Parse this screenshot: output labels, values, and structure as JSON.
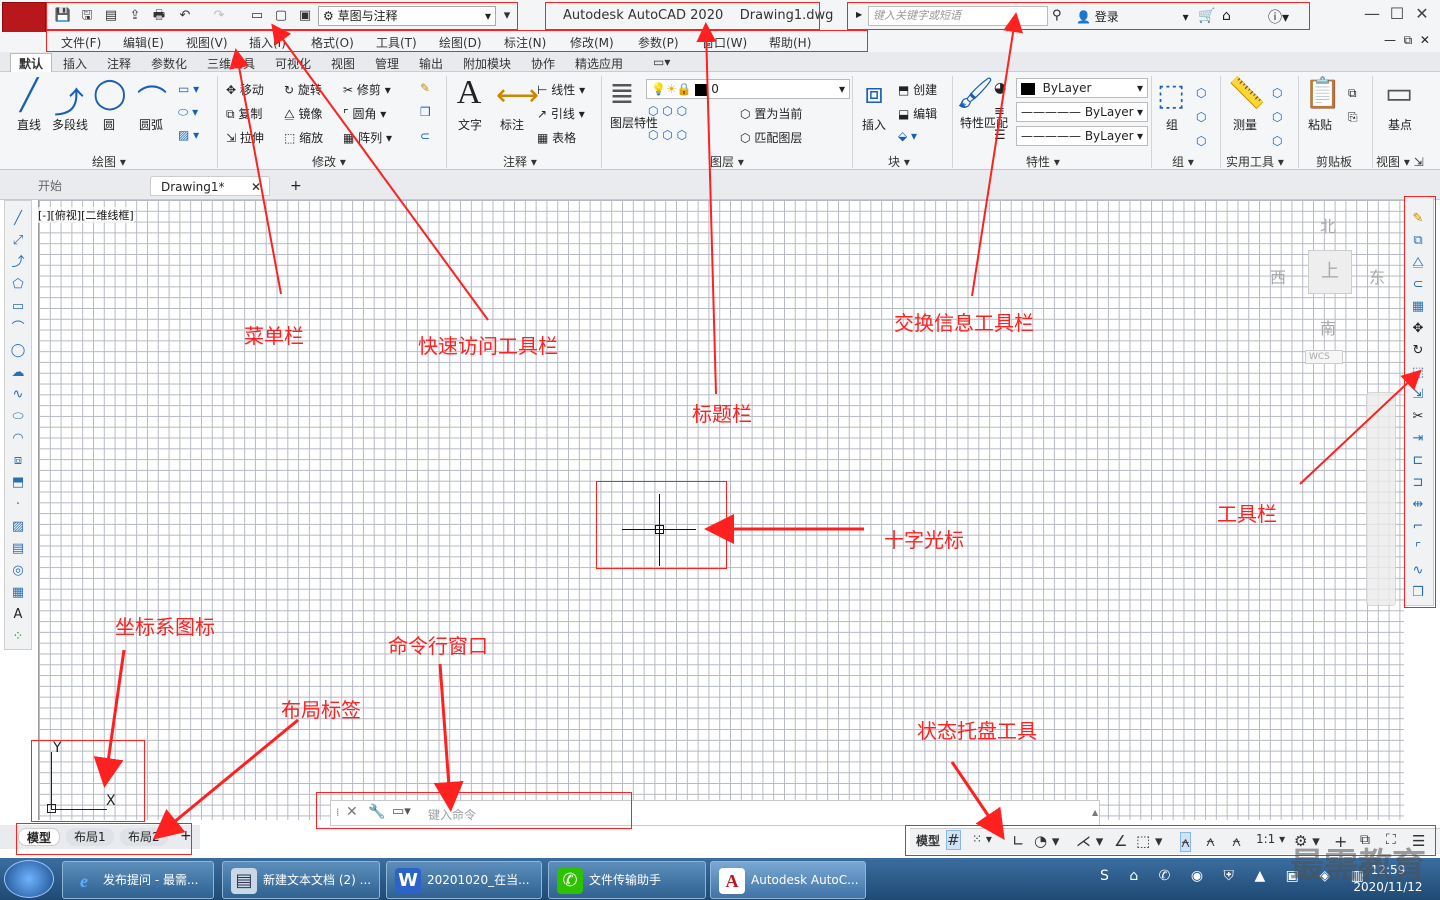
{
  "app": {
    "logo": "A",
    "workspace": "草图与注释",
    "title": "Autodesk AutoCAD 2020",
    "doc_name": "Drawing1.dwg",
    "search_placeholder": "键入关键字或短语",
    "login": "登录"
  },
  "menus": [
    "文件(F)",
    "编辑(E)",
    "视图(V)",
    "插入(I)",
    "格式(O)",
    "工具(T)",
    "绘图(D)",
    "标注(N)",
    "修改(M)",
    "参数(P)",
    "窗口(W)",
    "帮助(H)"
  ],
  "ribbon_tabs": [
    "默认",
    "插入",
    "注释",
    "参数化",
    "三维工具",
    "可视化",
    "视图",
    "管理",
    "输出",
    "附加模块",
    "协作",
    "精选应用"
  ],
  "ribbon": {
    "draw": {
      "title": "绘图",
      "line": "直线",
      "polyline": "多段线",
      "circle": "圆",
      "arc": "圆弧"
    },
    "modify": {
      "title": "修改",
      "move": "移动",
      "rotate": "旋转",
      "trim": "修剪",
      "copy": "复制",
      "mirror": "镜像",
      "fillet": "圆角",
      "stretch": "拉伸",
      "scale": "缩放",
      "array": "阵列"
    },
    "annotation": {
      "title": "注释",
      "text": "文字",
      "dimension": "标注",
      "linear": "线性",
      "leader": "引线",
      "table": "表格"
    },
    "layers": {
      "title": "图层",
      "props": "图层特性",
      "layer_value": "0",
      "set_current": "置为当前",
      "match": "匹配图层"
    },
    "block": {
      "title": "块",
      "insert": "插入",
      "create": "创建",
      "edit": "编辑"
    },
    "properties": {
      "title": "特性",
      "match": "特性匹配",
      "color": "ByLayer",
      "linetype": "ByLayer",
      "lineweight": "ByLayer"
    },
    "groups": {
      "title": "组",
      "group": "组"
    },
    "utilities": {
      "title": "实用工具",
      "measure": "测量"
    },
    "clipboard": {
      "title": "剪贴板",
      "paste": "粘贴"
    },
    "view": {
      "title": "视图",
      "base": "基点"
    }
  },
  "doc_tabs": [
    "开始",
    "Drawing1*"
  ],
  "viewport": {
    "label": "[-][俯视][二维线框]",
    "north": "北",
    "south": "南",
    "east": "东",
    "west": "西",
    "top": "上",
    "wcs": "WCS"
  },
  "layout_tabs": [
    "模型",
    "布局1",
    "布局2"
  ],
  "command": {
    "placeholder": "键入命令"
  },
  "status": {
    "model": "模型",
    "scale": "1:1"
  },
  "taskbar": {
    "items": [
      "发布提问 - 最需...",
      "新建文本文档 (2) ...",
      "20201020_在当...",
      "文件传输助手",
      "Autodesk AutoC..."
    ],
    "time": "12:59",
    "date": "2020/11/12"
  },
  "annotations": {
    "menubar": "菜单栏",
    "quick_access": "快速访问工具栏",
    "title_bar": "标题栏",
    "info_center": "交换信息工具栏",
    "crosshair": "十字光标",
    "toolbar": "工具栏",
    "ucs_icon": "坐标系图标",
    "command_window": "命令行窗口",
    "layout_tabs": "布局标签",
    "status_tray": "状态托盘工具"
  },
  "watermark": "最需教育"
}
